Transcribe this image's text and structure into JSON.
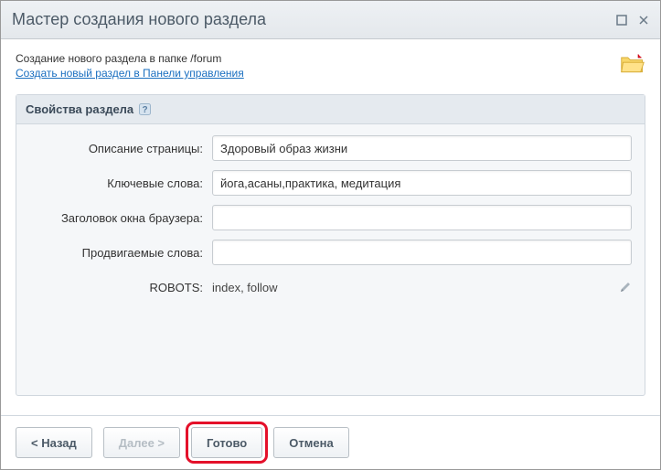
{
  "dialog": {
    "title": "Мастер создания нового раздела"
  },
  "intro": {
    "line1": "Создание нового раздела в папке /forum",
    "link": "Создать новый раздел в Панели управления"
  },
  "panel": {
    "title": "Свойства раздела"
  },
  "form": {
    "description": {
      "label": "Описание страницы:",
      "value": "Здоровый образ жизни"
    },
    "keywords": {
      "label": "Ключевые слова:",
      "value": "йога,асаны,практика, медитация"
    },
    "browserTitle": {
      "label": "Заголовок окна браузера:",
      "value": ""
    },
    "promoted": {
      "label": "Продвигаемые слова:",
      "value": ""
    },
    "robots": {
      "label": "ROBOTS:",
      "value": "index, follow"
    }
  },
  "footer": {
    "back": "< Назад",
    "next": "Далее >",
    "finish": "Готово",
    "cancel": "Отмена"
  }
}
